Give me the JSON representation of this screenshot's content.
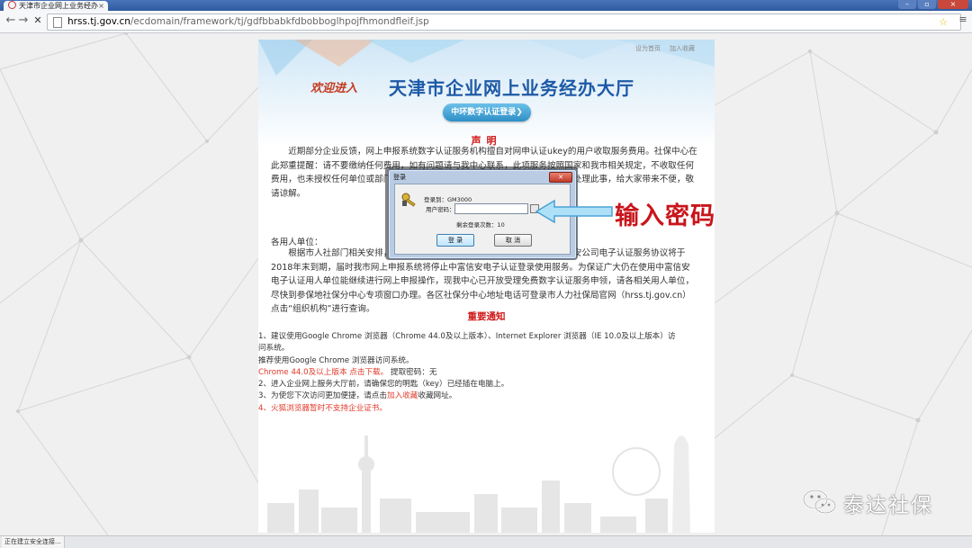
{
  "browser": {
    "tab_title": "天津市企业网上业务经办",
    "tab_close": "×",
    "window_buttons": [
      "–",
      "▫",
      "×"
    ],
    "nav": {
      "back": "←",
      "forward": "→",
      "reload": "✕"
    },
    "url_host": "hrss.tj.gov.cn",
    "url_path": "/ecdomain/framework/tj/gdfbbabkfdbobboglhpojfhmondfleif.jsp",
    "star": "☆",
    "menu": "≡",
    "status": "正在建立安全连接..."
  },
  "page": {
    "top_links": [
      "设为首页",
      "加入收藏"
    ],
    "welcome": "欢迎进入",
    "site_title": "天津市企业网上业务经办大厅",
    "ca_login_button": "中环数字认证登录❯",
    "notice_title": "声明",
    "notice_body": "近期部分企业反馈，网上申报系统数字认证服务机构擅自对网申认证ukey的用户收取服务费用。社保中心在此郑重提醒：请不要缴纳任何费用，如有问题请与我中心联系，此项服务按照国家和我市相关规定，不收取任何费用，也未授权任何单位或部门收取费用，如有人以此名义收费，我中心将依法处理此事，给大家带来不便，敬请谅解。",
    "salutation": "各用人单位：",
    "notice_body2": "根据市人社部门相关安排，我中心与天津市中环认证有限公司签订的中环信安公司电子认证服务协议将于2018年末到期，届时我市网上申报系统将停止中富信安电子认证登录使用服务。为保证广大仍在使用中富信安电子认证用人单位能继续进行网上申报操作，现我中心已开放受理免费数字认证服务申领，请各相关用人单位，尽快到参保地社保分中心专项窗口办理。各区社保分中心地址电话可登录市人力社保局官网（hrss.tj.gov.cn）点击“组织机构”进行查询。",
    "important_title": "重要通知",
    "tips": {
      "t1": "1、建议使用Google Chrome 浏览器（Chrome 44.0及以上版本）、Internet Explorer 浏览器（IE 10.0及以上版本）访",
      "t1b": "问系统。",
      "t2": "推荐使用Google Chrome 浏览器访问系统。",
      "t3_red": "Chrome 44.0及以上版本 点击下载。",
      "t3_rest": " 提取密码：无",
      "t4": "2、进入企业网上服务大厅前，请确保您的明匙（key）已经插在电脑上。",
      "t5_a": "3、为使您下次访问更加便捷，请点击",
      "t5_link": "加入收藏",
      "t5_b": "收藏网址。",
      "t6": "4、火狐浏览器暂时不支持企业证书。"
    }
  },
  "dialog": {
    "title": "登录",
    "close": "✕",
    "login_to_label": "登录到：GM3000",
    "password_label": "用户密码：",
    "password_value": "",
    "remaining_label": "剩余登录次数：10",
    "ok_button": "登 录",
    "cancel_button": "取 消"
  },
  "annotation": {
    "text": "输入密码",
    "color": "#c8151b"
  },
  "watermark": {
    "text": "泰达社保"
  },
  "colors": {
    "title_blue": "#1d5aa6",
    "notice_red": "#d01818",
    "dialog_frame": "#b9cce4"
  }
}
